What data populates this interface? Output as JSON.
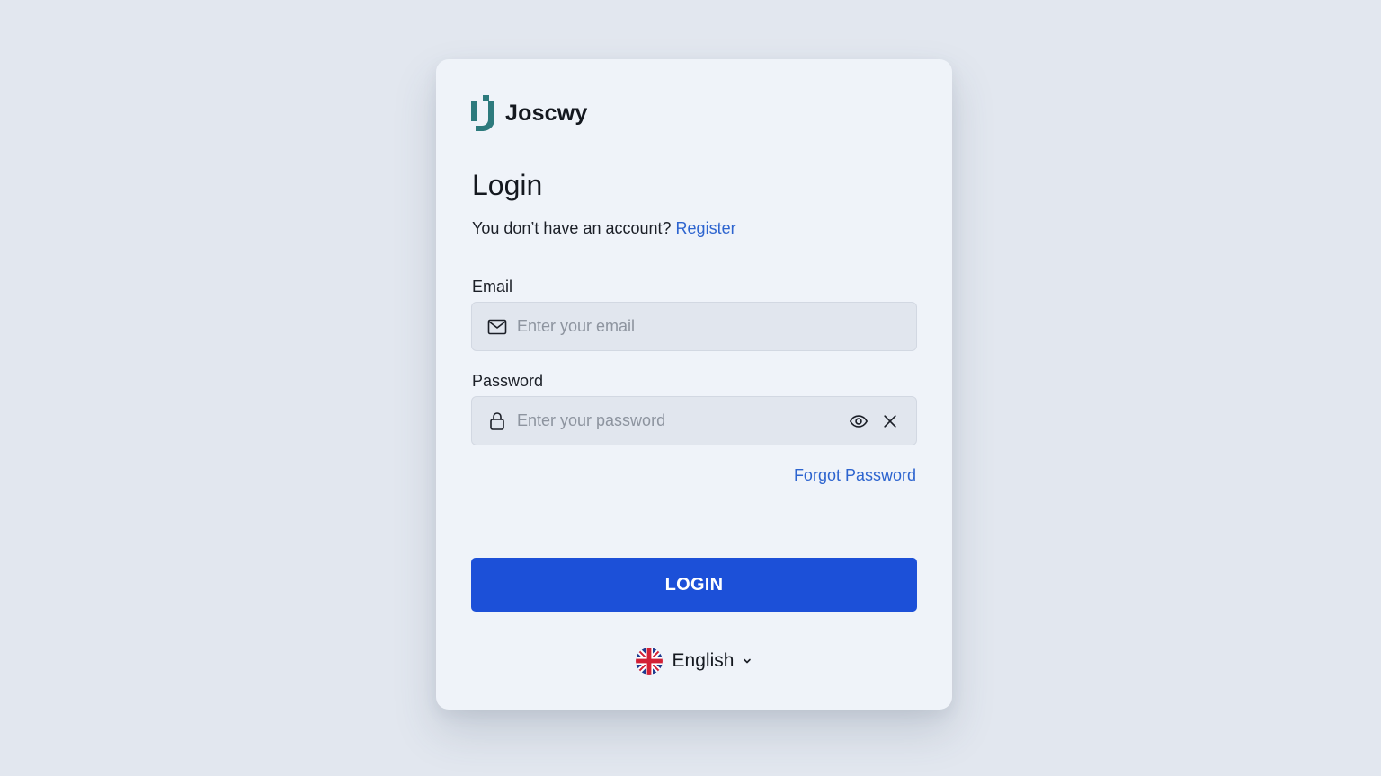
{
  "brand": {
    "name": "Joscwy",
    "logo_color": "#2d7a7d"
  },
  "login": {
    "title": "Login",
    "register_prompt": "You don’t have an account?",
    "register_link": "Register",
    "email_label": "Email",
    "email_placeholder": "Enter your email",
    "email_value": "",
    "password_label": "Password",
    "password_placeholder": "Enter your password",
    "password_value": "",
    "forgot_password": "Forgot Password",
    "submit_label": "LOGIN"
  },
  "language": {
    "selected": "English",
    "flag": "uk-flag-icon"
  },
  "icons": {
    "email": "mail-icon",
    "password": "lock-icon",
    "toggle_visibility": "eye-icon",
    "clear": "close-icon",
    "dropdown": "chevron-down-icon"
  },
  "colors": {
    "background": "#e2e7ef",
    "card": "#eff3f9",
    "accent": "#1c50d8",
    "link": "#2d64cf"
  }
}
